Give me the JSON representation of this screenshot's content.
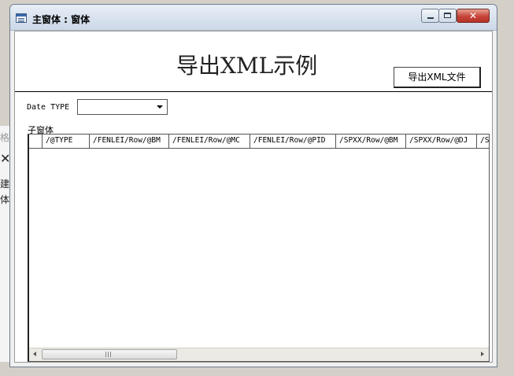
{
  "background_window": {
    "text_top": "格",
    "close_glyph": "✕",
    "text_1": "建",
    "text_2": "体"
  },
  "window": {
    "title": "主窗体 : 窗体",
    "close_glyph": "✕"
  },
  "form": {
    "title": "导出XML示例",
    "export_button_label": "导出XML文件",
    "date_type_label": "Date TYPE",
    "date_type_value": "",
    "subform_label": "子窗体"
  },
  "grid": {
    "columns": [
      {
        "label": "/@TYPE"
      },
      {
        "label": "/FENLEI/Row/@BM"
      },
      {
        "label": "/FENLEI/Row/@MC"
      },
      {
        "label": "/FENLEI/Row/@PID"
      },
      {
        "label": "/SPXX/Row/@BM"
      },
      {
        "label": "/SPXX/Row/@DJ"
      },
      {
        "label": "/S"
      }
    ],
    "rows": []
  },
  "colors": {
    "titlebar": "#cbd8e8",
    "close_button": "#c7443a",
    "form_background": "#ffffff"
  }
}
